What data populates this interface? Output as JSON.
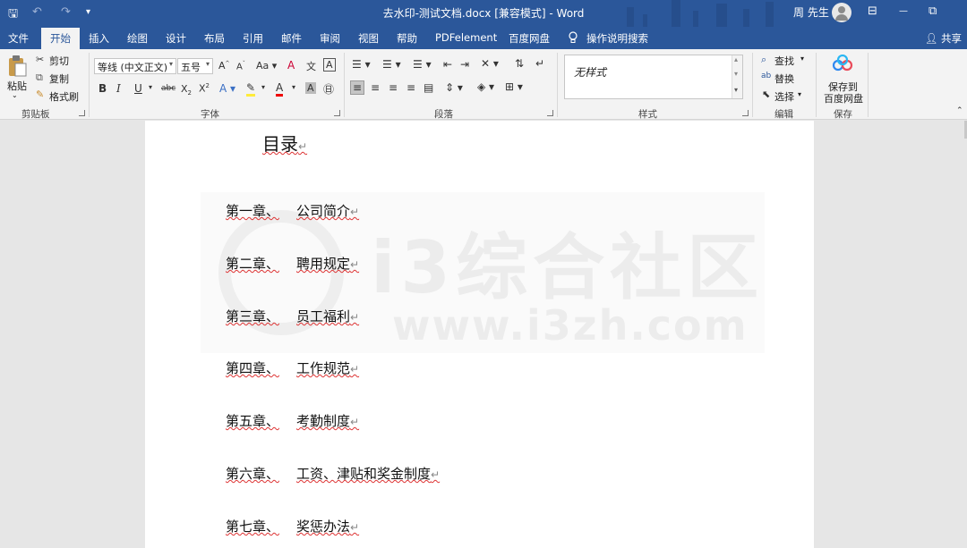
{
  "titlebar": {
    "title": "去水印-测试文档.docx [兼容模式]  -  Word",
    "user": "周 先生",
    "quick_access": {
      "save": "🖫",
      "undo": "↶",
      "redo": "↷",
      "customize": "▾"
    },
    "window": {
      "ribbon_options": "⊟",
      "minimize": "—",
      "restore": "⧉"
    }
  },
  "tabs": [
    "文件",
    "开始",
    "插入",
    "绘图",
    "设计",
    "布局",
    "引用",
    "邮件",
    "审阅",
    "视图",
    "帮助",
    "PDFelement",
    "百度网盘"
  ],
  "active_tab": "开始",
  "tell_me": "操作说明搜索",
  "share": "共享",
  "ribbon": {
    "clipboard": {
      "paste": "粘贴",
      "cut": "剪切",
      "copy": "复制",
      "format_painter": "格式刷",
      "label": "剪贴板"
    },
    "font": {
      "font_name": "等线 (中文正文)",
      "font_size": "五号",
      "label": "字体"
    },
    "paragraph": {
      "label": "段落"
    },
    "styles": {
      "current": "无样式",
      "label": "样式"
    },
    "editing": {
      "find": "查找",
      "replace": "替换",
      "select": "选择",
      "label": "编辑"
    },
    "save": {
      "save_to_baidu": "保存到",
      "save_to_baidu_2": "百度网盘",
      "label": "保存"
    }
  },
  "document": {
    "title": "目录",
    "paragraph_mark": "↵",
    "watermark": {
      "main": "i3综合社区",
      "url": "www.i3zh.com"
    },
    "entries": [
      {
        "chapter": "第一章、",
        "name": "公司简介"
      },
      {
        "chapter": "第二章、",
        "name": "聘用规定"
      },
      {
        "chapter": "第三章、",
        "name": "员工福利"
      },
      {
        "chapter": "第四章、",
        "name": "工作规范"
      },
      {
        "chapter": "第五章、",
        "name": "考勤制度"
      },
      {
        "chapter": "第六章、",
        "name": "工资、津贴和奖金制度"
      },
      {
        "chapter": "第七章、",
        "name": "奖惩办法"
      }
    ]
  },
  "colors": {
    "word_blue": "#2b579a",
    "ribbon_bg": "#f3f3f3",
    "canvas_bg": "#e6e6e6"
  }
}
